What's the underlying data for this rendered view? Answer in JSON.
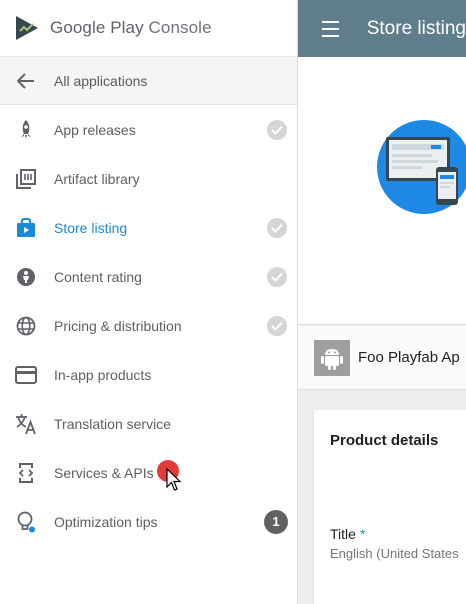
{
  "brand": {
    "name_primary": "Google Play",
    "name_secondary": "Console"
  },
  "sidebar": {
    "back": {
      "label": "All applications"
    },
    "items": [
      {
        "label": "App releases",
        "icon": "rocket-icon",
        "status": "check"
      },
      {
        "label": "Artifact library",
        "icon": "library-icon",
        "status": ""
      },
      {
        "label": "Store listing",
        "icon": "store-icon",
        "status": "check",
        "active": true
      },
      {
        "label": "Content rating",
        "icon": "rating-icon",
        "status": "check"
      },
      {
        "label": "Pricing & distribution",
        "icon": "globe-icon",
        "status": "check"
      },
      {
        "label": "In-app products",
        "icon": "card-icon",
        "status": ""
      },
      {
        "label": "Translation service",
        "icon": "translate-icon",
        "status": ""
      },
      {
        "label": "Services & APIs",
        "icon": "code-icon",
        "status": ""
      },
      {
        "label": "Optimization tips",
        "icon": "lightbulb-icon",
        "status": "badge",
        "badge": "1"
      }
    ]
  },
  "topbar": {
    "title": "Store listing"
  },
  "app": {
    "name": "Foo Playfab Ap"
  },
  "product": {
    "heading": "Product details",
    "title_label": "Title",
    "title_required": "*",
    "title_locale": "English (United States"
  },
  "colors": {
    "accent": "#1a8bd6",
    "topbar": "#607d8b",
    "cursor_dot": "#e23b3b"
  }
}
